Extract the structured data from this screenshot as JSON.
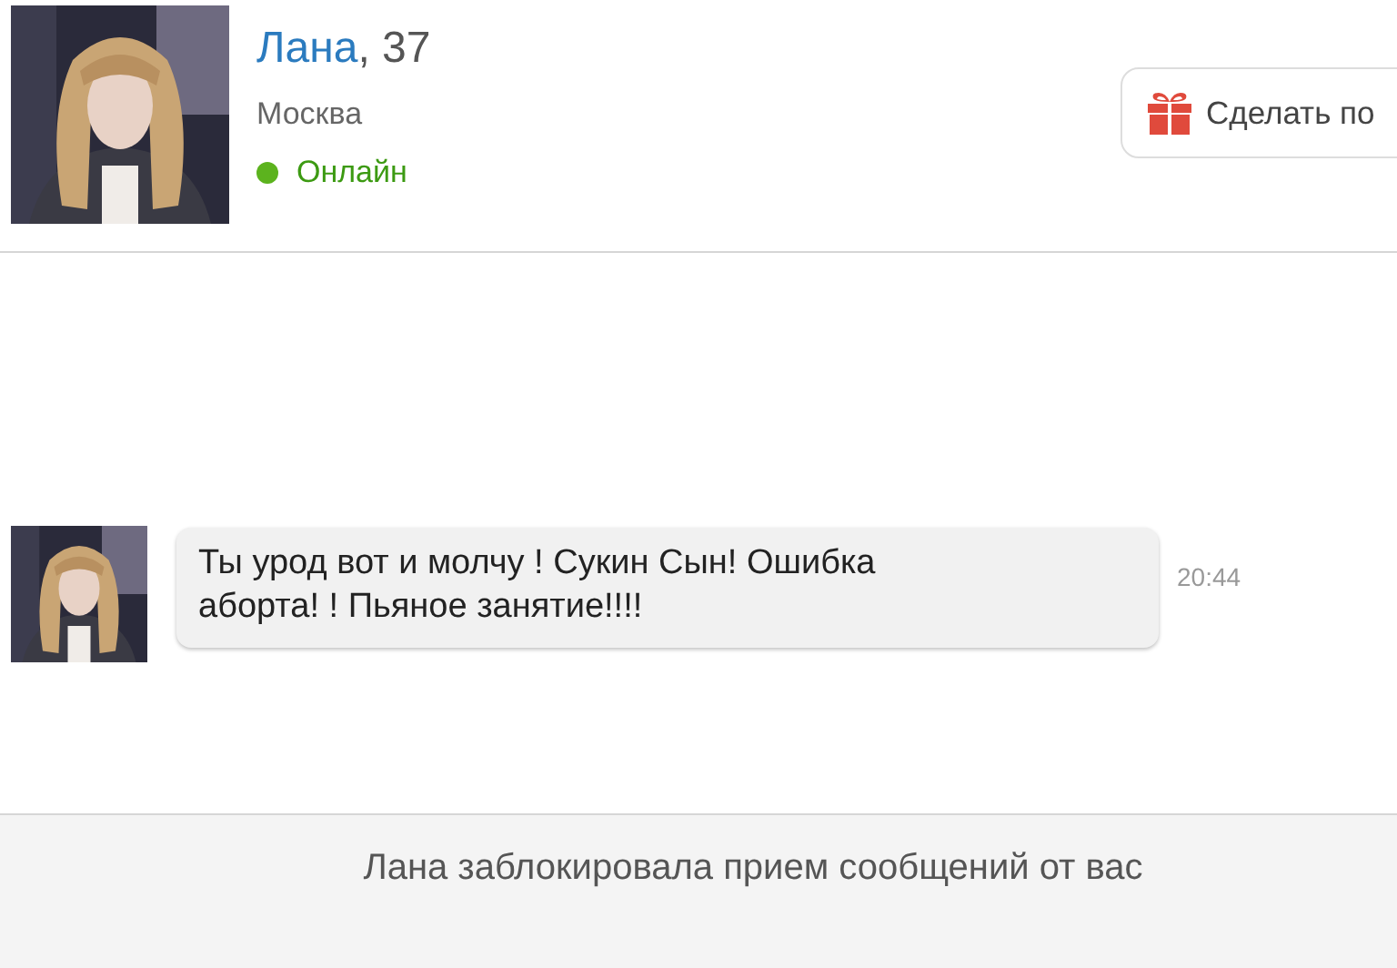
{
  "profile": {
    "name": "Лана",
    "age": ", 37",
    "city": "Москва",
    "status": {
      "label": "Онлайн",
      "online": true
    }
  },
  "gift_button": {
    "label": "Сделать по"
  },
  "messages": [
    {
      "text": "Ты урод вот и молчу ! Сукин Сын! Ошибка аборта! ! Пьяное занятие!!!!",
      "time": "20:44"
    }
  ],
  "notice": "Лана заблокировала прием сообщений от вас"
}
